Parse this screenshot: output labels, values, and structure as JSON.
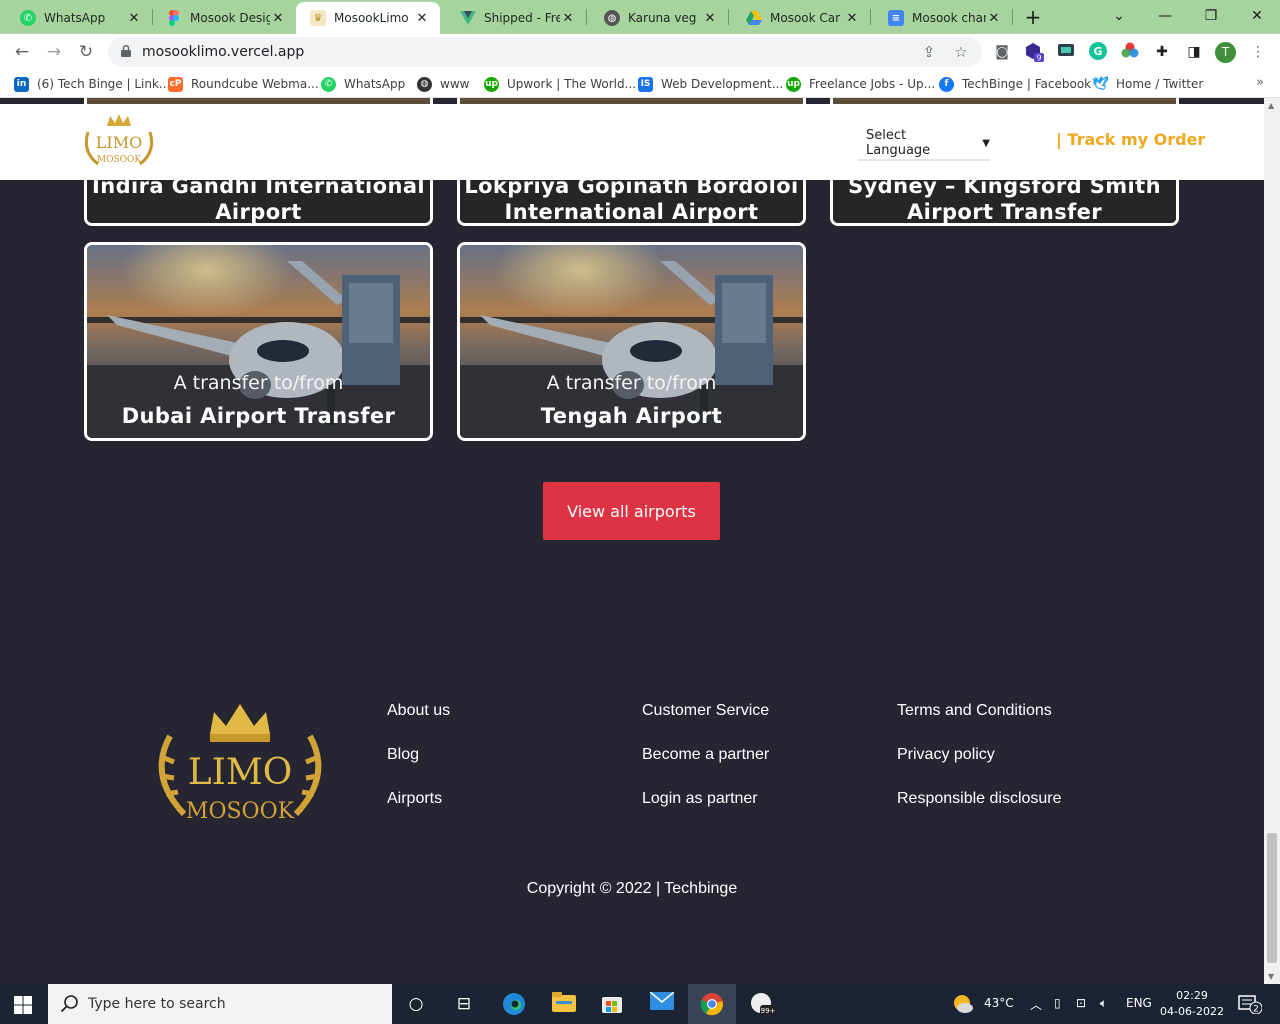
{
  "browser": {
    "tabs": [
      {
        "title": "WhatsApp",
        "icon": "whatsapp-icon",
        "color": "#25d366"
      },
      {
        "title": "Mosook Design",
        "icon": "figma-icon",
        "color": "#f24e1e"
      },
      {
        "title": "MosookLimo |",
        "icon": "limo-crown-icon",
        "color": "#d9b45a"
      },
      {
        "title": "Shipped - Free",
        "icon": "vue-icon",
        "color": "#41b883"
      },
      {
        "title": "Karuna veg",
        "icon": "globe-icon",
        "color": "#555555"
      },
      {
        "title": "Mosook Car Im",
        "icon": "google-drive-icon",
        "color": "#1fa463"
      },
      {
        "title": "Mosook chang",
        "icon": "google-docs-icon",
        "color": "#4285f4"
      }
    ],
    "url": "mosooklimo.vercel.app",
    "profile_initial": "T",
    "extension_badge": "9",
    "bookmarks": [
      {
        "label": "(6) Tech Binge | Link...",
        "icon": "linkedin-icon",
        "color": "#0a66c2"
      },
      {
        "label": "Roundcube Webma...",
        "icon": "cpanel-icon",
        "color": "#ff6c2c"
      },
      {
        "label": "WhatsApp",
        "icon": "whatsapp-icon",
        "color": "#25d366"
      },
      {
        "label": "www",
        "icon": "globe-icon",
        "color": "#333333"
      },
      {
        "label": "Upwork | The World...",
        "icon": "upwork-icon",
        "color": "#14a800"
      },
      {
        "label": "Web Development...",
        "icon": "is-icon",
        "color": "#1a73e8"
      },
      {
        "label": "Freelance Jobs - Up...",
        "icon": "upwork-icon",
        "color": "#14a800"
      },
      {
        "label": "TechBinge | Facebook",
        "icon": "facebook-icon",
        "color": "#1877f2"
      },
      {
        "label": "Home / Twitter",
        "icon": "twitter-icon",
        "color": "#1d9bf0"
      }
    ]
  },
  "site": {
    "header": {
      "logo_text_top": "LIMO",
      "logo_text_bottom": "MOSOOK",
      "language_select": "Select Language",
      "track_order": "| Track my Order"
    },
    "cards_top": [
      {
        "name_lines": [
          "Indira Gandhi International",
          "Airport"
        ]
      },
      {
        "name_lines": [
          "Lokpriya Gopinath Bordoloi",
          "International Airport Transfer"
        ]
      },
      {
        "name_lines": [
          "Sydney – Kingsford Smith",
          "Airport Transfer"
        ]
      }
    ],
    "cards": [
      {
        "subtitle": "A transfer to/from",
        "name": "Dubai Airport Transfer"
      },
      {
        "subtitle": "A transfer to/from",
        "name": "Tengah Airport"
      }
    ],
    "view_all": "View all airports",
    "footer": {
      "logo_text_top": "LIMO",
      "logo_text_bottom": "MOSOOK",
      "col1": [
        "About us",
        "Blog",
        "Airports"
      ],
      "col2": [
        "Customer Service",
        "Become a partner",
        "Login as partner"
      ],
      "col3": [
        "Terms and Conditions",
        "Privacy policy",
        "Responsible disclosure"
      ],
      "copyright": "Copyright © 2022 | Techbinge"
    }
  },
  "taskbar": {
    "search_placeholder": "Type here to search",
    "temperature": "43°C",
    "language": "ENG",
    "time": "02:29",
    "date": "04-06-2022",
    "notification_count": "2",
    "app_badge": "99+"
  },
  "colors": {
    "accent_red": "#dc3444",
    "track_orange": "#f0a81e",
    "page_bg": "#262632",
    "gold": "#d4a93a"
  }
}
